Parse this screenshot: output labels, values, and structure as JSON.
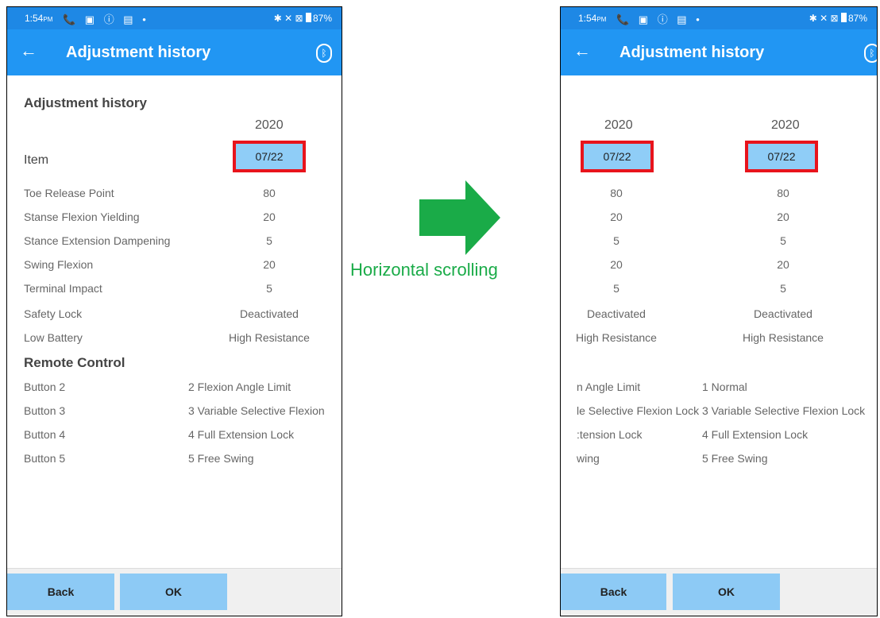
{
  "status": {
    "time": "1:54",
    "ampm": "PM",
    "left_icons": "📞 ▣ ⓘ ▤ •",
    "right_icons": "✱ ✕ ⊠",
    "battery": "87%"
  },
  "appbar": {
    "title": "Adjustment history",
    "back_icon": "←",
    "bluetooth_icon": "ᛒ"
  },
  "history": {
    "heading": "Adjustment history",
    "item_header": "Item",
    "year": "2020",
    "date": "07/22",
    "items": [
      {
        "label": "Toe Release Point",
        "value": "80"
      },
      {
        "label": "Stanse Flexion Yielding",
        "value": "20"
      },
      {
        "label": "Stance Extension Dampening",
        "value": "5"
      },
      {
        "label": "Swing Flexion",
        "value": "20"
      },
      {
        "label": "Terminal Impact",
        "value": "5"
      },
      {
        "label": "Safety Lock",
        "value": "Deactivated"
      },
      {
        "label": "Low Battery",
        "value": "High Resistance"
      }
    ],
    "remote_heading": "Remote Control",
    "remote": [
      {
        "label": "Button 2",
        "value": "2 Flexion Angle Limit"
      },
      {
        "label": "Button 3",
        "value": "3 Variable Selective Flexion"
      },
      {
        "label": "Button 4",
        "value": "4 Full Extension Lock"
      },
      {
        "label": "Button 5",
        "value": "5 Free Swing"
      }
    ]
  },
  "scrolled": {
    "col1": {
      "year": "2020",
      "date": "07/22",
      "values": [
        "80",
        "20",
        "5",
        "20",
        "5",
        "Deactivated",
        "High Resistance"
      ],
      "remote": [
        "n Angle Limit",
        "le Selective Flexion Lock",
        ":tension Lock",
        "wing"
      ]
    },
    "col2": {
      "year": "2020",
      "date": "07/22",
      "values": [
        "80",
        "20",
        "5",
        "20",
        "5",
        "Deactivated",
        "High Resistance"
      ],
      "remote": [
        "1 Normal",
        "3 Variable Selective Flexion Lock",
        "4 Full Extension Lock",
        "5 Free Swing"
      ]
    }
  },
  "footer": {
    "back_label": "Back",
    "ok_label": "OK"
  },
  "annotation": {
    "label": "Horizontal scrolling",
    "arrow_color": "#1aab48"
  },
  "colors": {
    "appbar": "#2196f3",
    "statusbar": "#1e88e5",
    "button": "#8dcaf5",
    "highlight": "#e8141c"
  }
}
